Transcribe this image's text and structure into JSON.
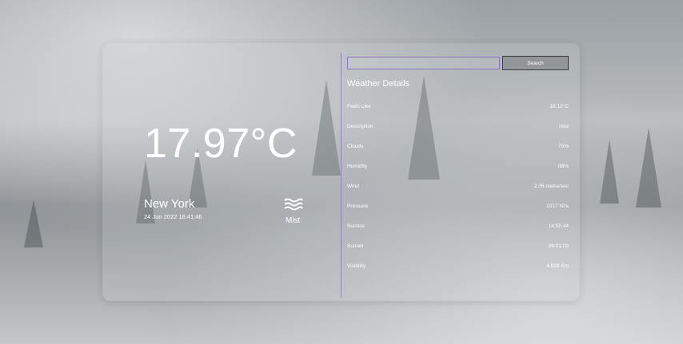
{
  "current": {
    "temperature": "17.97°C",
    "city": "New York",
    "datetime": "24 Jun 2022 16:41:46",
    "condition": "Mist",
    "condition_icon": "mist-icon"
  },
  "search": {
    "placeholder": "",
    "value": "",
    "button_label": "Search"
  },
  "details": {
    "title": "Weather Details",
    "rows": [
      {
        "label": "Feels Like",
        "value": "18.12°C"
      },
      {
        "label": "Description",
        "value": "mist"
      },
      {
        "label": "Clouds",
        "value": "75%"
      },
      {
        "label": "Humidity",
        "value": "88%"
      },
      {
        "label": "Wind",
        "value": "2.06 metre/sec"
      },
      {
        "label": "Pressure",
        "value": "1017 hPa"
      },
      {
        "label": "Sunrise",
        "value": "14:55:44"
      },
      {
        "label": "Sunset",
        "value": "06:01:03"
      },
      {
        "label": "Visibility",
        "value": "4.828 Km"
      }
    ]
  },
  "colors": {
    "accent": "#8a76c0",
    "text": "#ffffff"
  }
}
